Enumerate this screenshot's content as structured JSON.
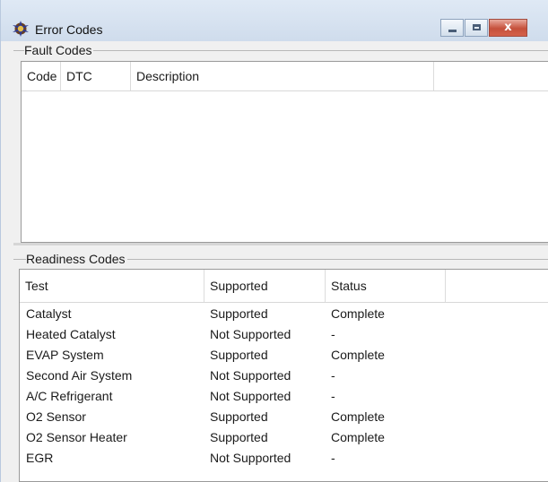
{
  "window": {
    "title": "Error Codes",
    "close_glyph": "x"
  },
  "fault_codes": {
    "group_label": "Fault Codes",
    "columns": [
      "Code",
      "DTC",
      "Description"
    ],
    "rows": []
  },
  "readiness_codes": {
    "group_label": "Readiness Codes",
    "columns": [
      "Test",
      "Supported",
      "Status"
    ],
    "rows": [
      [
        "Catalyst",
        "Supported",
        "Complete"
      ],
      [
        "Heated Catalyst",
        "Not Supported",
        "-"
      ],
      [
        "EVAP System",
        "Supported",
        "Complete"
      ],
      [
        "Second Air System",
        "Not Supported",
        "-"
      ],
      [
        "A/C Refrigerant",
        "Not Supported",
        "-"
      ],
      [
        "O2 Sensor",
        "Supported",
        "Complete"
      ],
      [
        "O2 Sensor Heater",
        "Supported",
        "Complete"
      ],
      [
        "EGR",
        "Not Supported",
        "-"
      ]
    ]
  }
}
